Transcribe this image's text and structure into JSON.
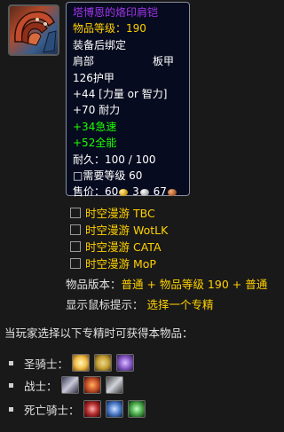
{
  "item": {
    "icon": "shoulder-armor-icon",
    "name": "塔博恩的烙印肩铠",
    "item_level": "物品等级：190",
    "bind": "装备后绑定",
    "slot": "肩部",
    "armor_type": "板甲",
    "armor": "126护甲",
    "primary_stat": "+44 [力量 or 智力]",
    "stamina": "+70 耐力",
    "haste": "+34急速",
    "versatility": "+52全能",
    "durability": "耐久：100 / 100",
    "required_level": "□需要等级 60",
    "sell_label": "售价：",
    "sell_gold": "60",
    "sell_silver": "3",
    "sell_copper": "67"
  },
  "timewalking": [
    {
      "label": "时空漫游 TBC"
    },
    {
      "label": "时空漫游 WotLK"
    },
    {
      "label": "时空漫游 CATA"
    },
    {
      "label": "时空漫游 MoP"
    }
  ],
  "version": {
    "label": "物品版本：",
    "value": "普通 + 物品等级 190 + 普通"
  },
  "mouseover": {
    "label": "显示鼠标提示：",
    "value": "选择一个专精"
  },
  "obtain_sentence": "当玩家选择以下专精时可获得本物品：",
  "classes": [
    {
      "name": "圣骑士：",
      "specs": [
        "holy-spec-icon",
        "protection-spec-icon",
        "retribution-spec-icon"
      ],
      "colors": [
        "#f2c14a",
        "#c9a235",
        "#8a5ac8"
      ]
    },
    {
      "name": "战士：",
      "specs": [
        "arms-spec-icon",
        "fury-spec-icon",
        "protection-spec-icon"
      ],
      "colors": [
        "#8a8fa8",
        "#c8522a",
        "#9aa0a8"
      ]
    },
    {
      "name": "死亡骑士：",
      "specs": [
        "blood-spec-icon",
        "frost-spec-icon",
        "unholy-spec-icon"
      ],
      "colors": [
        "#b02a2a",
        "#4a7ac8",
        "#4aa84a"
      ]
    }
  ]
}
